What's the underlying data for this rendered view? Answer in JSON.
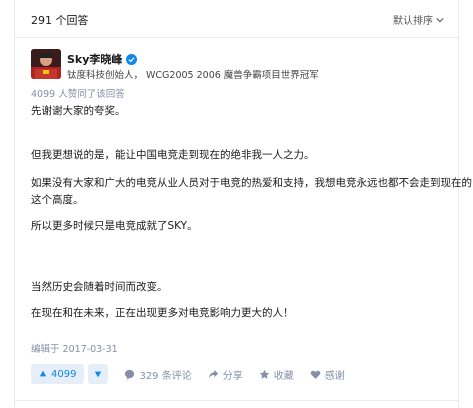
{
  "header": {
    "answer_count": "291 个回答",
    "sort_label": "默认排序"
  },
  "author": {
    "name": "Sky李晓峰",
    "bio": "钛度科技创始人， WCG2005 2006 魔兽争霸项目世界冠军"
  },
  "votes_summary": "4099 人赞同了该回答",
  "content": {
    "lines": [
      "先谢谢大家的夸奖。",
      "但我更想说的是，能让中国电竞走到现在的绝非我一人之力。",
      "如果没有大家和广大的电竞从业人员对于电竞的热爱和支持，我想电竞永远也都不会走到现在的",
      "这个高度。",
      "所以更多时候只是电竞成就了SKY。",
      "当然历史会随着时间而改变。",
      "在现在和在未来，正在出现更多对电竞影响力更大的人！"
    ]
  },
  "edited": "编辑于 2017-03-31",
  "actions": {
    "upvote_count": "4099",
    "comments": "329 条评论",
    "share": "分享",
    "favorite": "收藏",
    "thanks": "感谢"
  },
  "colors": {
    "accent": "#0f88eb",
    "accent_bg": "#e5eef9",
    "muted": "#8590a6"
  },
  "icons": [
    "chevron-down-icon",
    "verified-icon",
    "upvote-arrow-icon",
    "downvote-arrow-icon",
    "comment-icon",
    "share-icon",
    "star-icon",
    "heart-icon"
  ]
}
